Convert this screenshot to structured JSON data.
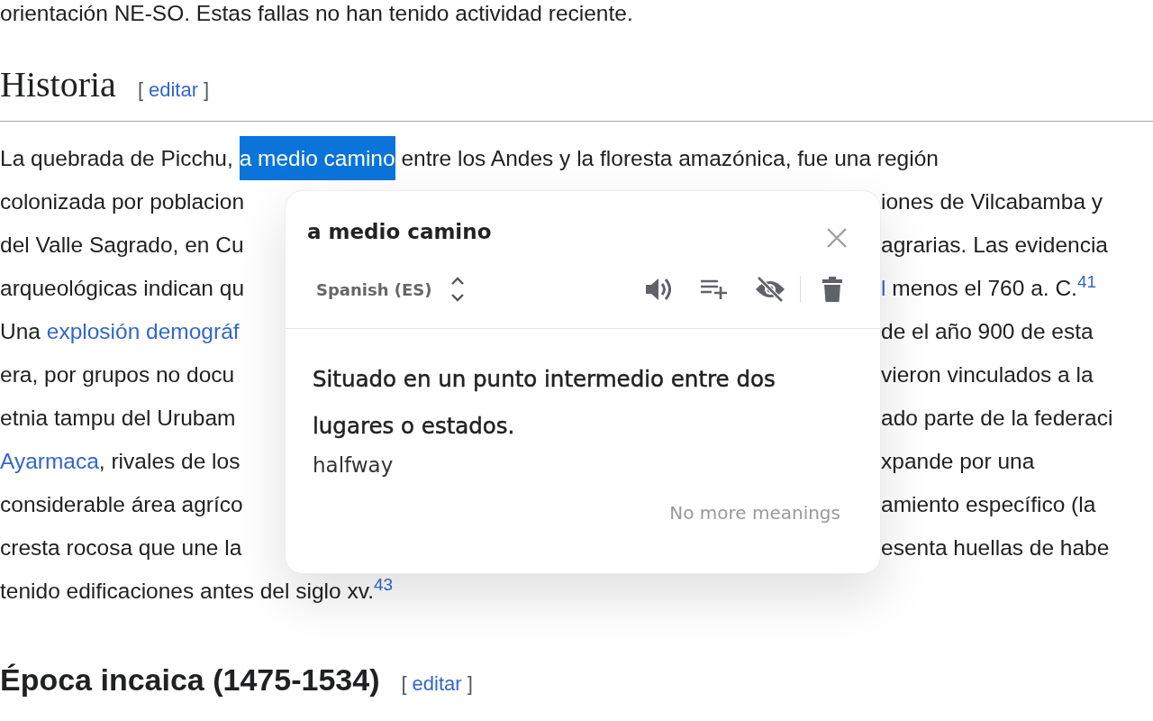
{
  "article": {
    "top_line": "orientación NE-SO. Estas fallas no han tenido actividad reciente.",
    "section": {
      "title": "Historia",
      "brackets": [
        "[",
        "]"
      ],
      "edit_link": "editar"
    },
    "lines": [
      {
        "left": [
          {
            "kind": "text",
            "text": "La quebrada de Picchu, "
          },
          {
            "kind": "highlight",
            "text": "a medio camino"
          },
          {
            "kind": "text",
            "text": " entre los Andes y la floresta amazónica, fue una región"
          }
        ]
      },
      {
        "left": [
          {
            "kind": "text",
            "text": "colonizada por poblacion"
          }
        ],
        "right": [
          {
            "kind": "text",
            "text": "iones de Vilcabamba y"
          }
        ]
      },
      {
        "left": [
          {
            "kind": "text",
            "text": "del Valle Sagrado, en Cu"
          }
        ],
        "right": [
          {
            "kind": "text",
            "text": "agrarias. Las evidencia"
          }
        ]
      },
      {
        "left": [
          {
            "kind": "text",
            "text": "arqueológicas indican qu"
          }
        ],
        "right": [
          {
            "kind": "link",
            "text": "l"
          },
          {
            "kind": "text",
            "text": " menos el 760 a. C."
          },
          {
            "kind": "sup",
            "text": "41"
          }
        ]
      },
      {
        "left": [
          {
            "kind": "text",
            "text": "Una "
          },
          {
            "kind": "link",
            "text": "explosión demográf"
          }
        ],
        "right": [
          {
            "kind": "text",
            "text": "de el año 900 de esta"
          }
        ]
      },
      {
        "left": [
          {
            "kind": "text",
            "text": "era, por grupos no docu"
          }
        ],
        "right": [
          {
            "kind": "text",
            "text": "vieron vinculados a la"
          }
        ]
      },
      {
        "left": [
          {
            "kind": "text",
            "text": "etnia tampu del Urubam"
          }
        ],
        "right": [
          {
            "kind": "text",
            "text": "ado parte de la federaci"
          }
        ]
      },
      {
        "left": [
          {
            "kind": "link",
            "text": "Ayarmaca"
          },
          {
            "kind": "text",
            "text": ", rivales de los"
          }
        ],
        "right": [
          {
            "kind": "text",
            "text": "xpande por una"
          }
        ]
      },
      {
        "left": [
          {
            "kind": "text",
            "text": "considerable área agríco"
          }
        ],
        "right": [
          {
            "kind": "text",
            "text": "amiento específico (la"
          }
        ]
      },
      {
        "left": [
          {
            "kind": "text",
            "text": "cresta rocosa que une la"
          }
        ],
        "right": [
          {
            "kind": "text",
            "text": "esenta huellas de habe"
          }
        ]
      },
      {
        "left": [
          {
            "kind": "text",
            "text": "tenido edificaciones antes del siglo xv."
          },
          {
            "kind": "sup",
            "text": "43"
          }
        ]
      }
    ],
    "next_section": {
      "title": "Época incaica (1475-1534)",
      "brackets": [
        "[",
        "]"
      ],
      "edit_link": "editar"
    }
  },
  "popup": {
    "term": "a medio camino",
    "language": "Spanish (ES)",
    "definition": "Situado en un punto intermedio entre dos lugares o estados.",
    "translation": "halfway",
    "footer": "No more meanings"
  }
}
